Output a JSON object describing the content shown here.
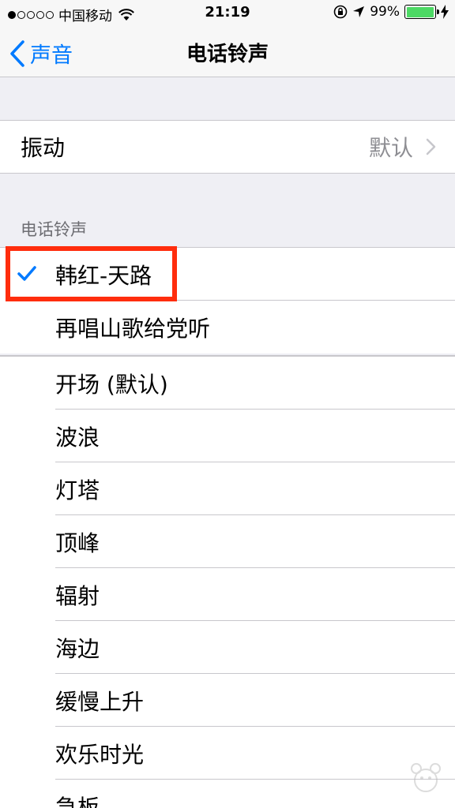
{
  "status_bar": {
    "carrier": "中国移动",
    "time": "21:19",
    "battery": "99%",
    "battery_level": 0.99,
    "battery_color": "#4cd964"
  },
  "nav": {
    "back_label": "声音",
    "title": "电话铃声"
  },
  "vibration": {
    "label": "振动",
    "value": "默认"
  },
  "section_header": "电话铃声",
  "custom_ringtones": [
    {
      "name": "韩红-天路",
      "selected": true
    },
    {
      "name": "再唱山歌给党听",
      "selected": false
    }
  ],
  "ringtones": [
    "开场 (默认)",
    "波浪",
    "灯塔",
    "顶峰",
    "辐射",
    "海边",
    "缓慢上升",
    "欢乐时光",
    "急板"
  ],
  "colors": {
    "accent": "#007aff",
    "highlight": "#ff2d0d"
  }
}
